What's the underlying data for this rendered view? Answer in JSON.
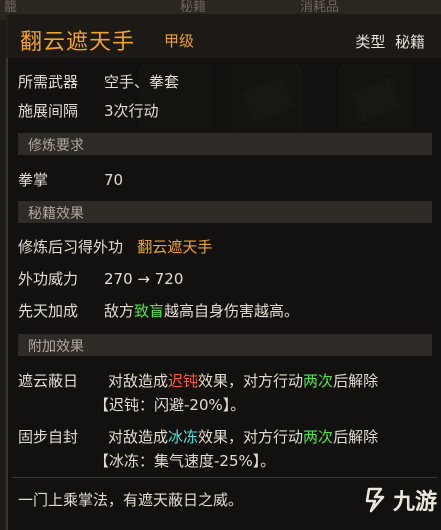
{
  "background": {
    "tabs": [
      "籠",
      "秘籍",
      "消耗品"
    ]
  },
  "header": {
    "title": "翻云遮天手",
    "grade": "甲级",
    "type_label": "类型",
    "type_value": "秘籍"
  },
  "info": [
    {
      "label": "所需武器",
      "value": "空手、拳套"
    },
    {
      "label": "施展间隔",
      "value": "3次行动"
    }
  ],
  "sections": {
    "requirements": "修炼要求",
    "effects": "秘籍效果",
    "extra": "附加效果"
  },
  "requirement": {
    "label": "拳掌",
    "value": "70"
  },
  "learned": {
    "label": "修炼后习得外功",
    "value": "翻云遮天手"
  },
  "power": {
    "label": "外功威力",
    "value": "270 → 720"
  },
  "innate": {
    "label": "先天加成",
    "pre": "敌方",
    "highlight": "致盲",
    "post": "越高自身伤害越高。"
  },
  "extra_effects": [
    {
      "label": "遮云蔽日",
      "line1_pre": "对敌造成",
      "status": "迟钝",
      "line1_mid": "效果，对方行动",
      "count": "两次",
      "line1_post": "后解除",
      "line2": "【迟钝：闪避-20%】。"
    },
    {
      "label": "固步自封",
      "line1_pre": "对敌造成",
      "status": "冰冻",
      "line1_mid": "效果，对方行动",
      "count": "两次",
      "line1_post": "后解除",
      "line2": "【冰冻：集气速度-25%】。"
    }
  ],
  "description": "一门上乘掌法，有遮天蔽日之威。",
  "watermark": {
    "text": "九游",
    "icon": "jiuyou-logo-icon"
  },
  "colors": {
    "title": "#f0a52a",
    "green_highlight": "#55e34a",
    "red_status": "#ff5a42",
    "cyan_status": "#49e3dd"
  }
}
